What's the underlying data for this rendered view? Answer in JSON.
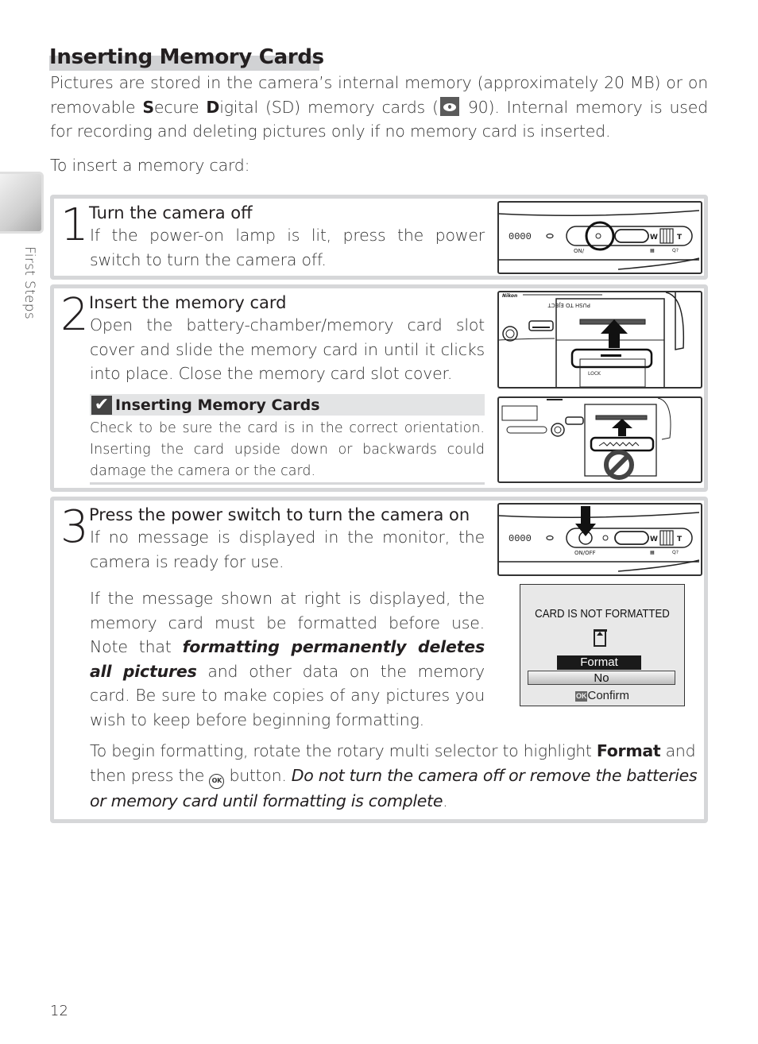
{
  "page": {
    "title": "Inserting Memory Cards",
    "intro": {
      "part1": "Pictures are stored in the camera’s internal memory (approximately 20 MB) or on removable ",
      "s_bold": "S",
      "part2": "ecure ",
      "d_bold": "D",
      "part3": "igital (SD) memory cards (",
      "ref_icon": "reference-eye-icon",
      "ref_page": " 90",
      "part4": ").  Internal memory is used for recording and deleting pictures only if no memory card is inserted."
    },
    "lead": "To insert a memory card:",
    "side_tab": {
      "label": "First Steps"
    },
    "page_number": "12"
  },
  "steps": [
    {
      "number": "1",
      "title": "Turn the camera off",
      "body": "If the power-on lamp is lit, press the power switch to turn the camera off.",
      "illustration": {
        "name": "camera-top-power-switch-circled",
        "label": "ON/"
      }
    },
    {
      "number": "2",
      "title": "Insert the memory card",
      "body": "Open the battery-chamber/memory card slot cover and slide the memory card in until it clicks into place.  Close the memory card slot cover.",
      "illustration": {
        "name": "card-slot-insert-correct",
        "brand": "Nikon",
        "slot_label": "PUSH TO EJECT",
        "lock_label": "LOCK"
      },
      "note": {
        "icon": "check-icon",
        "title": "Inserting Memory Cards",
        "body": "Check to be sure the card is in the correct orientation.  Inserting the card upside down or backwards could damage the camera or the card.",
        "illustration": {
          "name": "card-slot-insert-wrong",
          "symbol": "prohibited-icon"
        }
      }
    },
    {
      "number": "3",
      "title": "Press the power switch to turn the camera on",
      "body": "If no message is displayed in the monitor, the camera is ready for use.",
      "illustration": {
        "name": "camera-top-power-switch-pressed",
        "label": "ON/OFF"
      },
      "para2_a": "If the message shown at right is displayed, the memory card must be formatted before use.  Note that ",
      "para2_em": "formatting permanently deletes all pictures",
      "para2_b": " and other data on the memory card.  Be sure to make copies of any pictures you wish to keep before beginning formatting.",
      "lcd": {
        "message": "CARD IS NOT FORMATTED",
        "options": [
          "Format",
          "No"
        ],
        "selected": "No",
        "ok_badge": "OK",
        "confirm": "Confirm"
      },
      "para3_a": "To begin formatting, rotate the rotary multi selector to highlight ",
      "para3_bold": "Format",
      "para3_b": " and then press the ",
      "para3_ok": "OK",
      "para3_c": " button.  ",
      "para3_em": "Do not turn the camera off or remove the batteries or memory card until formatting is complete",
      "para3_end": "."
    }
  ]
}
